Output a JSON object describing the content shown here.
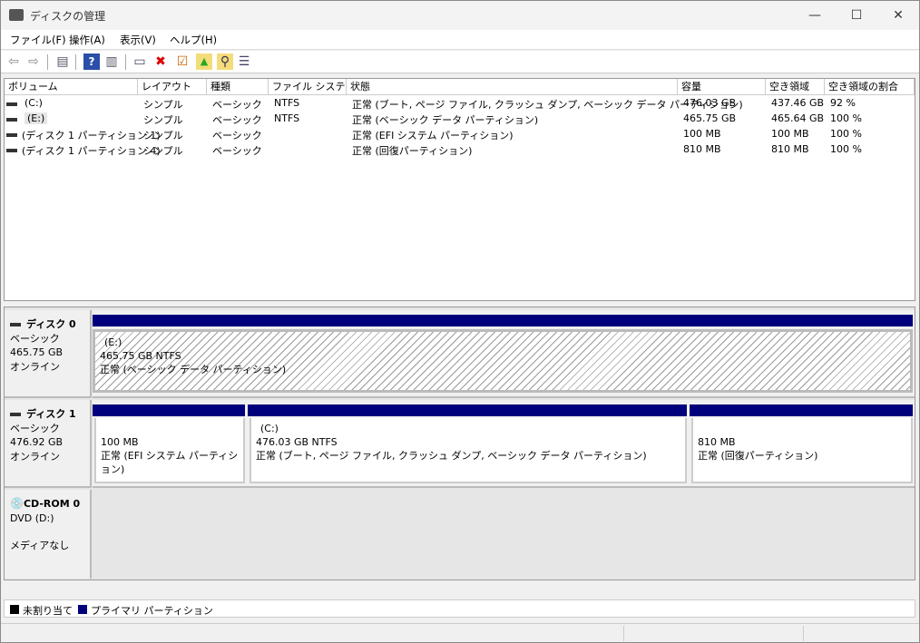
{
  "window": {
    "title": "ディスクの管理",
    "minimize": "—",
    "maximize": "☐",
    "close": "✕"
  },
  "menu": [
    "ファイル(F)",
    "操作(A)",
    "表示(V)",
    "ヘルプ(H)"
  ],
  "toolbar": [
    "back-icon",
    "forward-icon",
    "console-tree-icon",
    "help-icon",
    "action-pane-icon",
    "connect-drive-icon",
    "delete-icon",
    "properties-icon",
    "open-icon",
    "explore-icon",
    "list-icon"
  ],
  "columns": [
    "ボリューム",
    "レイアウト",
    "種類",
    "ファイル システム",
    "状態",
    "容量",
    "空き領域",
    "空き領域の割合"
  ],
  "volumes": [
    [
      "(C:)",
      "シンプル",
      "ベーシック",
      "NTFS",
      "正常 (ブート, ページ ファイル, クラッシュ ダンプ, ベーシック データ パーティション)",
      "476.03 GB",
      "437.46 GB",
      "92 %"
    ],
    [
      "(E:)",
      "シンプル",
      "ベーシック",
      "NTFS",
      "正常 (ベーシック データ パーティション)",
      "465.75 GB",
      "465.64 GB",
      "100 %"
    ],
    [
      "(ディスク 1 パーティション 1)",
      "シンプル",
      "ベーシック",
      "",
      "正常 (EFI システム パーティション)",
      "100 MB",
      "100 MB",
      "100 %"
    ],
    [
      "(ディスク 1 パーティション 4)",
      "シンプル",
      "ベーシック",
      "",
      "正常 (回復パーティション)",
      "810 MB",
      "810 MB",
      "100 %"
    ]
  ],
  "disks": [
    {
      "name": "ディスク 0",
      "type": "ベーシック",
      "size": "465.75 GB",
      "status": "オンライン",
      "partitions": [
        {
          "label": "(E:)",
          "size": "465.75 GB NTFS",
          "status": "正常 (ベーシック データ パーティション)"
        }
      ]
    },
    {
      "name": "ディスク 1",
      "type": "ベーシック",
      "size": "476.92 GB",
      "status": "オンライン",
      "partitions": [
        {
          "label": "",
          "size": "100 MB",
          "status": "正常 (EFI システム パーティション)"
        },
        {
          "label": "(C:)",
          "size": "476.03 GB NTFS",
          "status": "正常 (ブート, ページ ファイル, クラッシュ ダンプ, ベーシック データ パーティション)"
        },
        {
          "label": "",
          "size": "810 MB",
          "status": "正常 (回復パーティション)"
        }
      ]
    },
    {
      "name": "CD-ROM 0",
      "type": "DVD (D:)",
      "status": "メディアなし"
    }
  ],
  "legend": [
    {
      "label": "未割り当て",
      "color": "#000000"
    },
    {
      "label": "プライマリ パーティション",
      "color": "#00007c"
    }
  ]
}
